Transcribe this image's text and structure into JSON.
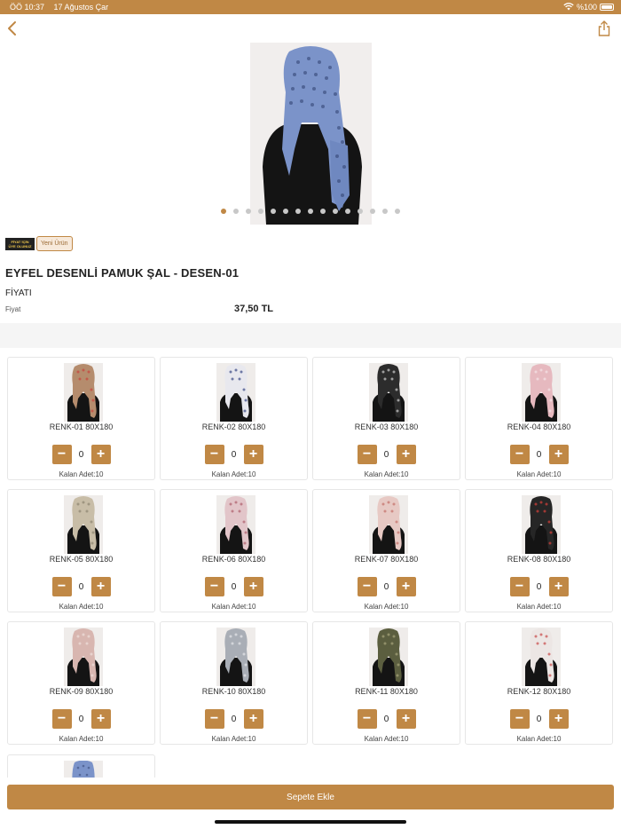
{
  "status_bar": {
    "time": "ÖÖ 10:37",
    "date": "17 Ağustos Çar",
    "battery": "%100"
  },
  "nav": {
    "back_icon": "chevron-left-icon",
    "share_icon": "share-icon"
  },
  "gallery": {
    "image_count": 15,
    "active_index": 0
  },
  "badges": {
    "members_badge_line1": "FİYAT İÇİN",
    "members_badge_line2": "ÜYE OLUNUZ",
    "new_badge": "Yeni Ürün"
  },
  "product": {
    "title": "EYFEL DESENLİ PAMUK ŞAL - DESEN-01",
    "price_heading": "FİYATI",
    "price_label": "Fiyat",
    "price_value": "37,50 TL"
  },
  "variants": [
    {
      "name": "RENK-01 80X180",
      "qty": "0",
      "remaining": "Kalan Adet:10"
    },
    {
      "name": "RENK-02 80X180",
      "qty": "0",
      "remaining": "Kalan Adet:10"
    },
    {
      "name": "RENK-03 80X180",
      "qty": "0",
      "remaining": "Kalan Adet:10"
    },
    {
      "name": "RENK-04 80X180",
      "qty": "0",
      "remaining": "Kalan Adet:10"
    },
    {
      "name": "RENK-05 80X180",
      "qty": "0",
      "remaining": "Kalan Adet:10"
    },
    {
      "name": "RENK-06 80X180",
      "qty": "0",
      "remaining": "Kalan Adet:10"
    },
    {
      "name": "RENK-07 80X180",
      "qty": "0",
      "remaining": "Kalan Adet:10"
    },
    {
      "name": "RENK-08 80X180",
      "qty": "0",
      "remaining": "Kalan Adet:10"
    },
    {
      "name": "RENK-09 80X180",
      "qty": "0",
      "remaining": "Kalan Adet:10"
    },
    {
      "name": "RENK-10 80X180",
      "qty": "0",
      "remaining": "Kalan Adet:10"
    },
    {
      "name": "RENK-11 80X180",
      "qty": "0",
      "remaining": "Kalan Adet:10"
    },
    {
      "name": "RENK-12 80X180",
      "qty": "0",
      "remaining": "Kalan Adet:10"
    }
  ],
  "cart": {
    "button_label": "Sepete Ekle"
  },
  "colors": {
    "accent": "#c08845",
    "background": "#ffffff",
    "band": "#f5f5f5"
  }
}
